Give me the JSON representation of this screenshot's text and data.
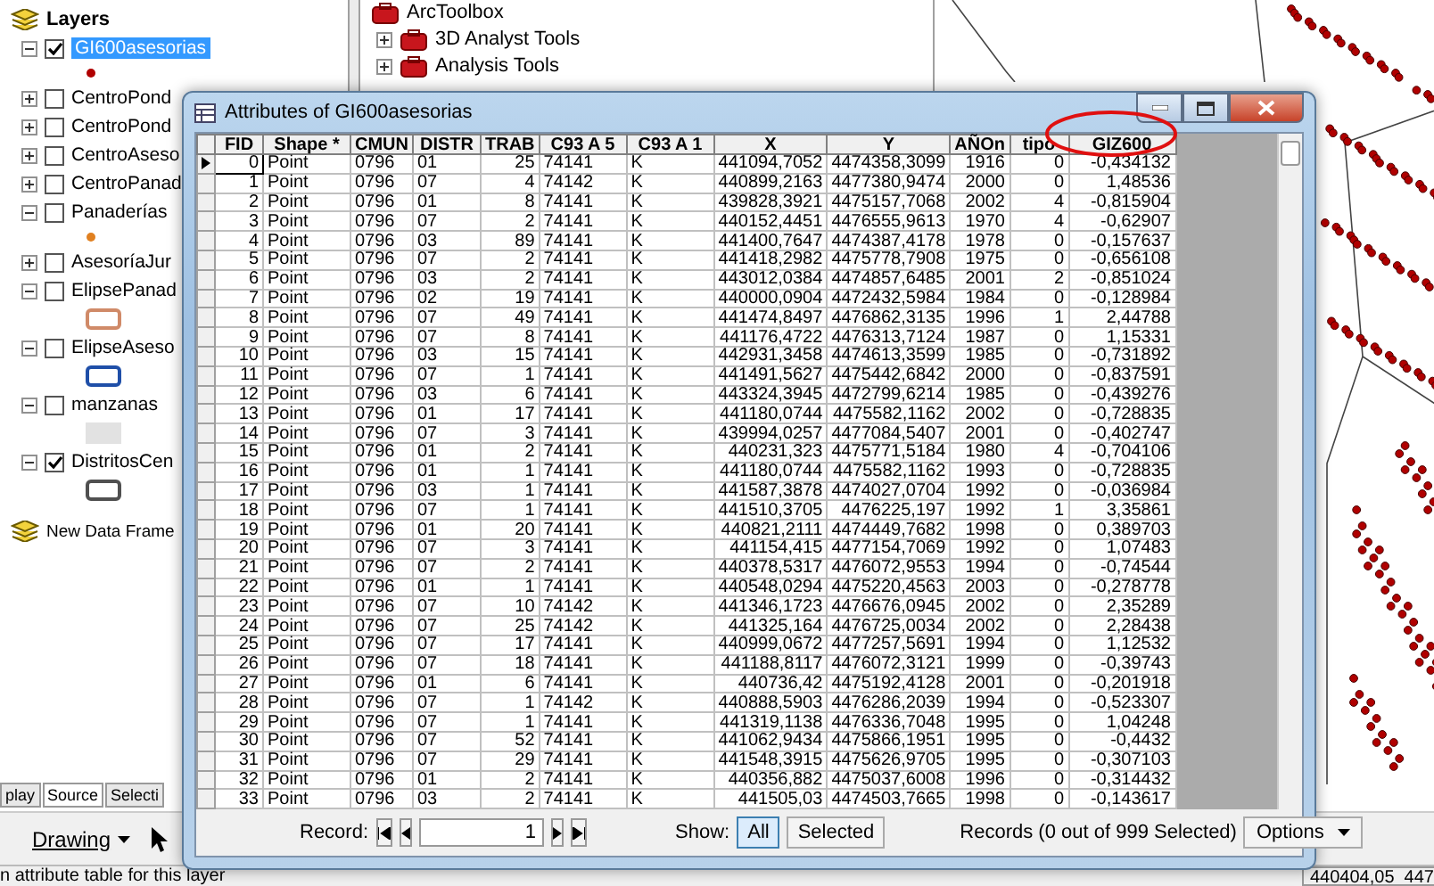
{
  "toc": {
    "title": "Layers",
    "layers": [
      {
        "name": "GI600asesorias",
        "checked": true,
        "selected": true,
        "expanded": true,
        "symbol": {
          "kind": "point",
          "color": "#b00000"
        }
      },
      {
        "name": "CentroPond",
        "checked": false,
        "selected": false,
        "expanded": false
      },
      {
        "name": "CentroPond",
        "checked": false,
        "selected": false,
        "expanded": false
      },
      {
        "name": "CentroAseso",
        "checked": false,
        "selected": false,
        "expanded": false
      },
      {
        "name": "CentroPanad",
        "checked": false,
        "selected": false,
        "expanded": false
      },
      {
        "name": "Panaderías",
        "checked": false,
        "selected": false,
        "expanded": true,
        "symbol": {
          "kind": "point",
          "color": "#e08020"
        }
      },
      {
        "name": "AsesoríaJur",
        "checked": false,
        "selected": false,
        "expanded": false
      },
      {
        "name": "ElipsePanad",
        "checked": false,
        "selected": false,
        "expanded": true,
        "symbol": {
          "kind": "outline",
          "color": "#d08a68"
        }
      },
      {
        "name": "ElipseAseso",
        "checked": false,
        "selected": false,
        "expanded": true,
        "symbol": {
          "kind": "outline",
          "color": "#1f4fa8"
        }
      },
      {
        "name": "manzanas",
        "checked": false,
        "selected": false,
        "expanded": true,
        "symbol": {
          "kind": "fill",
          "color": "#e2e2e2"
        }
      },
      {
        "name": "DistritosCen",
        "checked": true,
        "selected": false,
        "expanded": true,
        "symbol": {
          "kind": "outline",
          "color": "#505050"
        }
      }
    ],
    "new_frame": "New Data Frame",
    "tabs": [
      {
        "label": "play",
        "selected": false
      },
      {
        "label": "Source",
        "selected": true
      },
      {
        "label": "Selecti",
        "selected": false
      }
    ]
  },
  "toolbox": {
    "title": "ArcToolbox",
    "items": [
      {
        "label": "3D Analyst Tools",
        "expanded": false
      },
      {
        "label": "Analysis Tools",
        "expanded": false
      }
    ]
  },
  "window": {
    "title": "Attributes of GI600asesorias"
  },
  "table": {
    "columns": [
      "FID",
      "Shape *",
      "CMUN",
      "DISTR",
      "TRAB",
      "C93 A 5",
      "C93 A 1",
      "X",
      "Y",
      "AÑOn",
      "tipo",
      "GIZ600"
    ],
    "rows": [
      {
        "selected": true,
        "cells": [
          "0",
          "Point",
          "0796",
          "01",
          "25",
          "74141",
          "K",
          "441094,7052",
          "4474358,3099",
          "1916",
          "0",
          "-0,434132"
        ]
      },
      {
        "selected": false,
        "cells": [
          "1",
          "Point",
          "0796",
          "07",
          "4",
          "74142",
          "K",
          "440899,2163",
          "4477380,9474",
          "2000",
          "0",
          "1,48536"
        ]
      },
      {
        "selected": false,
        "cells": [
          "2",
          "Point",
          "0796",
          "01",
          "8",
          "74141",
          "K",
          "439828,3921",
          "4475157,7068",
          "2002",
          "4",
          "-0,815904"
        ]
      },
      {
        "selected": false,
        "cells": [
          "3",
          "Point",
          "0796",
          "07",
          "2",
          "74141",
          "K",
          "440152,4451",
          "4476555,9613",
          "1970",
          "4",
          "-0,62907"
        ]
      },
      {
        "selected": false,
        "cells": [
          "4",
          "Point",
          "0796",
          "03",
          "89",
          "74141",
          "K",
          "441400,7647",
          "4474387,4178",
          "1978",
          "0",
          "-0,157637"
        ]
      },
      {
        "selected": false,
        "cells": [
          "5",
          "Point",
          "0796",
          "07",
          "2",
          "74141",
          "K",
          "441418,2982",
          "4475778,7908",
          "1975",
          "0",
          "-0,656108"
        ]
      },
      {
        "selected": false,
        "cells": [
          "6",
          "Point",
          "0796",
          "03",
          "2",
          "74141",
          "K",
          "443012,0384",
          "4474857,6485",
          "2001",
          "2",
          "-0,851024"
        ]
      },
      {
        "selected": false,
        "cells": [
          "7",
          "Point",
          "0796",
          "02",
          "19",
          "74141",
          "K",
          "440000,0904",
          "4472432,5984",
          "1984",
          "0",
          "-0,128984"
        ]
      },
      {
        "selected": false,
        "cells": [
          "8",
          "Point",
          "0796",
          "07",
          "49",
          "74141",
          "K",
          "441474,8497",
          "4476862,3135",
          "1996",
          "1",
          "2,44788"
        ]
      },
      {
        "selected": false,
        "cells": [
          "9",
          "Point",
          "0796",
          "07",
          "8",
          "74141",
          "K",
          "441176,4722",
          "4476313,7124",
          "1987",
          "0",
          "1,15331"
        ]
      },
      {
        "selected": false,
        "cells": [
          "10",
          "Point",
          "0796",
          "03",
          "15",
          "74141",
          "K",
          "442931,3458",
          "4474613,3599",
          "1985",
          "0",
          "-0,731892"
        ]
      },
      {
        "selected": false,
        "cells": [
          "11",
          "Point",
          "0796",
          "07",
          "1",
          "74141",
          "K",
          "441491,5627",
          "4475442,6842",
          "2000",
          "0",
          "-0,837591"
        ]
      },
      {
        "selected": false,
        "cells": [
          "12",
          "Point",
          "0796",
          "03",
          "6",
          "74141",
          "K",
          "443324,3945",
          "4472799,6214",
          "1985",
          "0",
          "-0,439276"
        ]
      },
      {
        "selected": false,
        "cells": [
          "13",
          "Point",
          "0796",
          "01",
          "17",
          "74141",
          "K",
          "441180,0744",
          "4475582,1162",
          "2002",
          "0",
          "-0,728835"
        ]
      },
      {
        "selected": false,
        "cells": [
          "14",
          "Point",
          "0796",
          "07",
          "3",
          "74141",
          "K",
          "439994,0257",
          "4477084,5407",
          "2001",
          "0",
          "-0,402747"
        ]
      },
      {
        "selected": false,
        "cells": [
          "15",
          "Point",
          "0796",
          "01",
          "2",
          "74141",
          "K",
          "440231,323",
          "4475771,5184",
          "1980",
          "4",
          "-0,704106"
        ]
      },
      {
        "selected": false,
        "cells": [
          "16",
          "Point",
          "0796",
          "01",
          "1",
          "74141",
          "K",
          "441180,0744",
          "4475582,1162",
          "1993",
          "0",
          "-0,728835"
        ]
      },
      {
        "selected": false,
        "cells": [
          "17",
          "Point",
          "0796",
          "03",
          "1",
          "74141",
          "K",
          "441587,3878",
          "4474027,0704",
          "1992",
          "0",
          "-0,036984"
        ]
      },
      {
        "selected": false,
        "cells": [
          "18",
          "Point",
          "0796",
          "07",
          "1",
          "74141",
          "K",
          "441510,3705",
          "4476225,197",
          "1992",
          "1",
          "3,35861"
        ]
      },
      {
        "selected": false,
        "cells": [
          "19",
          "Point",
          "0796",
          "01",
          "20",
          "74141",
          "K",
          "440821,2111",
          "4474449,7682",
          "1998",
          "0",
          "0,389703"
        ]
      },
      {
        "selected": false,
        "cells": [
          "20",
          "Point",
          "0796",
          "07",
          "3",
          "74141",
          "K",
          "441154,415",
          "4477154,7069",
          "1992",
          "0",
          "1,07483"
        ]
      },
      {
        "selected": false,
        "cells": [
          "21",
          "Point",
          "0796",
          "07",
          "2",
          "74141",
          "K",
          "440378,5317",
          "4476072,9553",
          "1994",
          "0",
          "-0,74544"
        ]
      },
      {
        "selected": false,
        "cells": [
          "22",
          "Point",
          "0796",
          "01",
          "1",
          "74141",
          "K",
          "440548,0294",
          "4475220,4563",
          "2003",
          "0",
          "-0,278778"
        ]
      },
      {
        "selected": false,
        "cells": [
          "23",
          "Point",
          "0796",
          "07",
          "10",
          "74142",
          "K",
          "441346,1723",
          "4476676,0945",
          "2002",
          "0",
          "2,35289"
        ]
      },
      {
        "selected": false,
        "cells": [
          "24",
          "Point",
          "0796",
          "07",
          "25",
          "74142",
          "K",
          "441325,164",
          "4476725,0034",
          "2002",
          "0",
          "2,28438"
        ]
      },
      {
        "selected": false,
        "cells": [
          "25",
          "Point",
          "0796",
          "07",
          "17",
          "74141",
          "K",
          "440999,0672",
          "4477257,5691",
          "1994",
          "0",
          "1,12532"
        ]
      },
      {
        "selected": false,
        "cells": [
          "26",
          "Point",
          "0796",
          "07",
          "18",
          "74141",
          "K",
          "441188,8117",
          "4476072,3121",
          "1999",
          "0",
          "-0,39743"
        ]
      },
      {
        "selected": false,
        "cells": [
          "27",
          "Point",
          "0796",
          "01",
          "6",
          "74141",
          "K",
          "440736,42",
          "4475192,4128",
          "2001",
          "0",
          "-0,201918"
        ]
      },
      {
        "selected": false,
        "cells": [
          "28",
          "Point",
          "0796",
          "07",
          "1",
          "74142",
          "K",
          "440888,5903",
          "4476286,2039",
          "1994",
          "0",
          "-0,523307"
        ]
      },
      {
        "selected": false,
        "cells": [
          "29",
          "Point",
          "0796",
          "07",
          "1",
          "74141",
          "K",
          "441319,1138",
          "4476336,7048",
          "1995",
          "0",
          "1,04248"
        ]
      },
      {
        "selected": false,
        "cells": [
          "30",
          "Point",
          "0796",
          "07",
          "52",
          "74141",
          "K",
          "441062,9434",
          "4475866,1951",
          "1995",
          "0",
          "-0,4432"
        ]
      },
      {
        "selected": false,
        "cells": [
          "31",
          "Point",
          "0796",
          "07",
          "29",
          "74141",
          "K",
          "441548,3915",
          "4475626,9705",
          "1995",
          "0",
          "-0,307103"
        ]
      },
      {
        "selected": false,
        "cells": [
          "32",
          "Point",
          "0796",
          "01",
          "2",
          "74141",
          "K",
          "440356,882",
          "4475037,6008",
          "1996",
          "0",
          "-0,314432"
        ]
      },
      {
        "selected": false,
        "cells": [
          "33",
          "Point",
          "0796",
          "03",
          "2",
          "74141",
          "K",
          "441505,03",
          "4474503,7665",
          "1998",
          "0",
          "-0,143617"
        ]
      }
    ]
  },
  "footer": {
    "record_label": "Record:",
    "record_value": "1",
    "show_label": "Show:",
    "show_options": [
      {
        "label": "All",
        "selected": true
      },
      {
        "label": "Selected",
        "selected": false
      }
    ],
    "records_text": "Records (0 out of 999 Selected)",
    "options_button": "Options"
  },
  "toolbar": {
    "drawing": "Drawing"
  },
  "status_bar": {
    "message": "n attribute table for this layer",
    "coordinates": "440404,05  447"
  }
}
